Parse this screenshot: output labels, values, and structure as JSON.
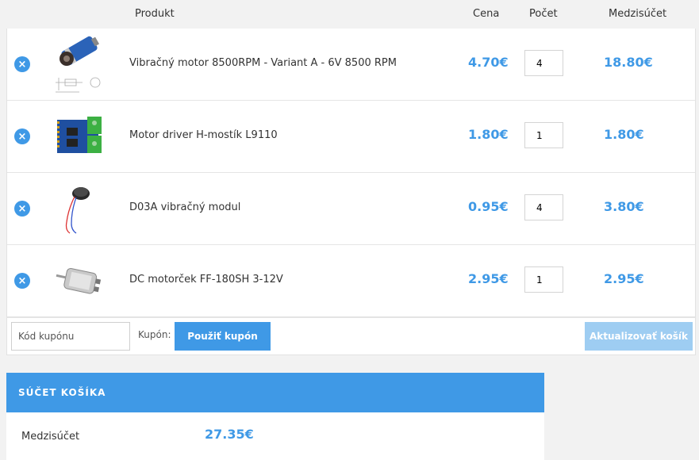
{
  "table": {
    "headers": {
      "product": "Produkt",
      "price": "Cena",
      "qty": "Počet",
      "subtotal": "Medzisúčet"
    },
    "items": [
      {
        "name": "Vibračný motor 8500RPM - Variant A - 6V 8500 RPM",
        "price": "4.70€",
        "qty": "4",
        "subtotal": "18.80€",
        "image": "vibration-motor-image"
      },
      {
        "name": "Motor driver H-mostík L9110",
        "price": "1.80€",
        "qty": "1",
        "subtotal": "1.80€",
        "image": "motor-driver-board-image"
      },
      {
        "name": "D03A vibračný modul",
        "price": "0.95€",
        "qty": "4",
        "subtotal": "3.80€",
        "image": "coin-vibration-module-image"
      },
      {
        "name": "DC motorček FF-180SH 3-12V",
        "price": "2.95€",
        "qty": "1",
        "subtotal": "2.95€",
        "image": "dc-motor-image"
      }
    ],
    "remove_symbol": "×"
  },
  "coupon": {
    "placeholder": "Kód kupónu",
    "label": "Kupón:",
    "apply_button": "Použiť kupón"
  },
  "update_button": "Aktualizovať košík",
  "totals": {
    "title": "SÚČET KOŠÍKA",
    "subtotal_label": "Medzisúčet",
    "subtotal_value": "27.35€"
  },
  "colors": {
    "accent": "#3f99e6",
    "disabled_button": "#9ecdf2"
  }
}
